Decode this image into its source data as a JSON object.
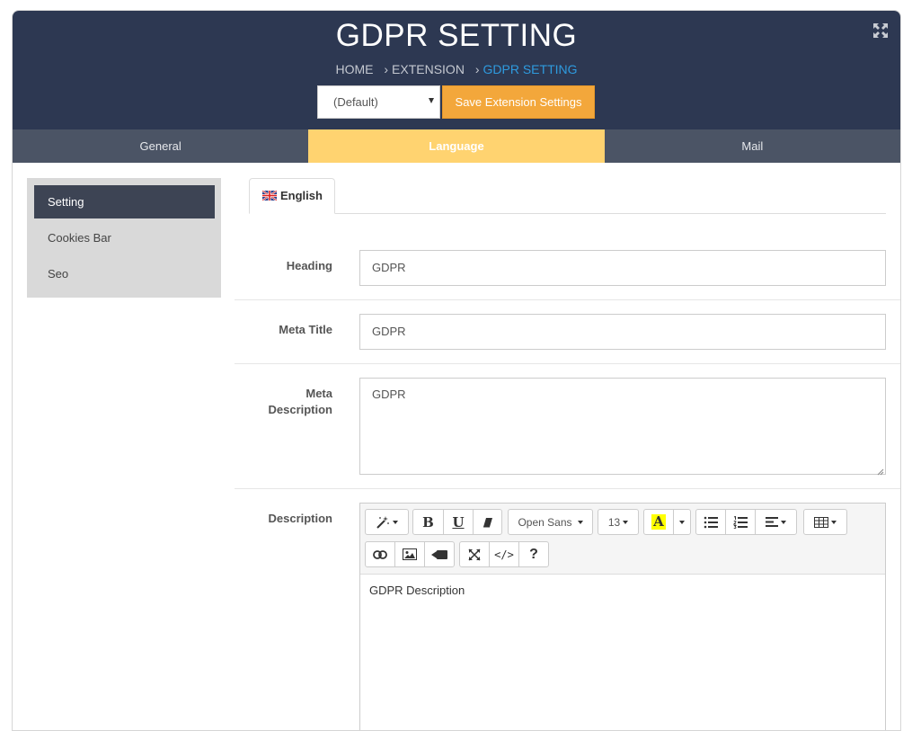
{
  "header": {
    "title": "GDPR SETTING",
    "breadcrumb": [
      {
        "label": "HOME"
      },
      {
        "label": "EXTENSION"
      },
      {
        "label": "GDPR SETTING"
      }
    ],
    "breadcrumb_separator": "›",
    "store_select_value": "(Default)",
    "save_button_label": "Save Extension Settings"
  },
  "tabs": [
    {
      "label": "General",
      "active": false
    },
    {
      "label": "Language",
      "active": true
    },
    {
      "label": "Mail",
      "active": false
    }
  ],
  "sidebar": {
    "items": [
      {
        "label": "Setting",
        "active": true
      },
      {
        "label": "Cookies Bar",
        "active": false
      },
      {
        "label": "Seo",
        "active": false
      }
    ]
  },
  "language_tab": {
    "label": "English",
    "icon": "uk-flag-icon"
  },
  "form": {
    "heading": {
      "label": "Heading",
      "value": "GDPR"
    },
    "meta_title": {
      "label": "Meta Title",
      "value": "GDPR"
    },
    "meta_description": {
      "label_line1": "Meta",
      "label_line2": "Description",
      "value": "GDPR"
    },
    "description": {
      "label": "Description",
      "content": "GDPR Description"
    }
  },
  "editor_toolbar": {
    "font_family": "Open Sans",
    "font_size": "13",
    "text_color_glyph": "A",
    "bold_glyph": "B",
    "underline_glyph": "U",
    "help_glyph": "?",
    "code_glyph": "</>"
  },
  "colors": {
    "header_bg": "#2d3852",
    "tabbar_bg": "#4b5465",
    "active_tab": "#ffd370",
    "accent_button": "#f3a73b",
    "breadcrumb_active": "#2e9bdf",
    "sidebar_active": "#3d4454",
    "sidebar_bg": "#d9d9d9"
  }
}
